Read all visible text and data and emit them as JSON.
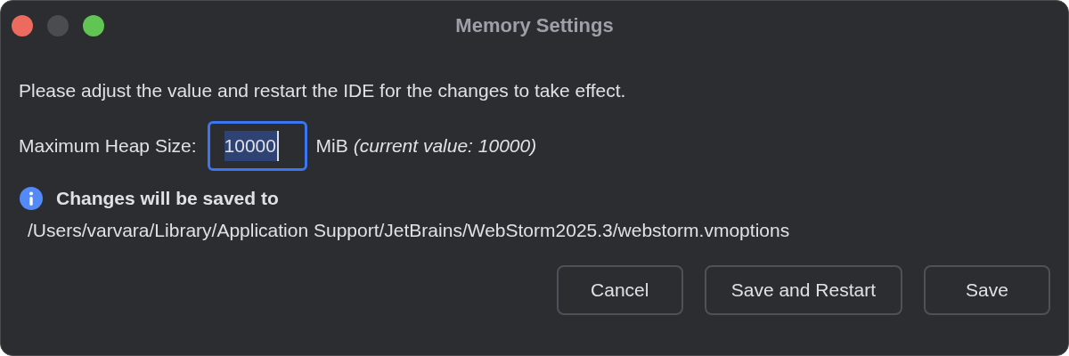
{
  "window": {
    "title": "Memory Settings"
  },
  "message": "Please adjust the value and restart the IDE for the changes to take effect.",
  "heap": {
    "label": "Maximum Heap Size:",
    "value": "10000",
    "value_selected": true,
    "focused": true,
    "unit": "MiB",
    "current": "(current value: 10000)"
  },
  "info": {
    "title": "Changes will be saved to",
    "path": "/Users/varvara/Library/Application Support/JetBrains/WebStorm2025.3/webstorm.vmoptions"
  },
  "buttons": [
    "Cancel",
    "Save and Restart",
    "Save"
  ]
}
